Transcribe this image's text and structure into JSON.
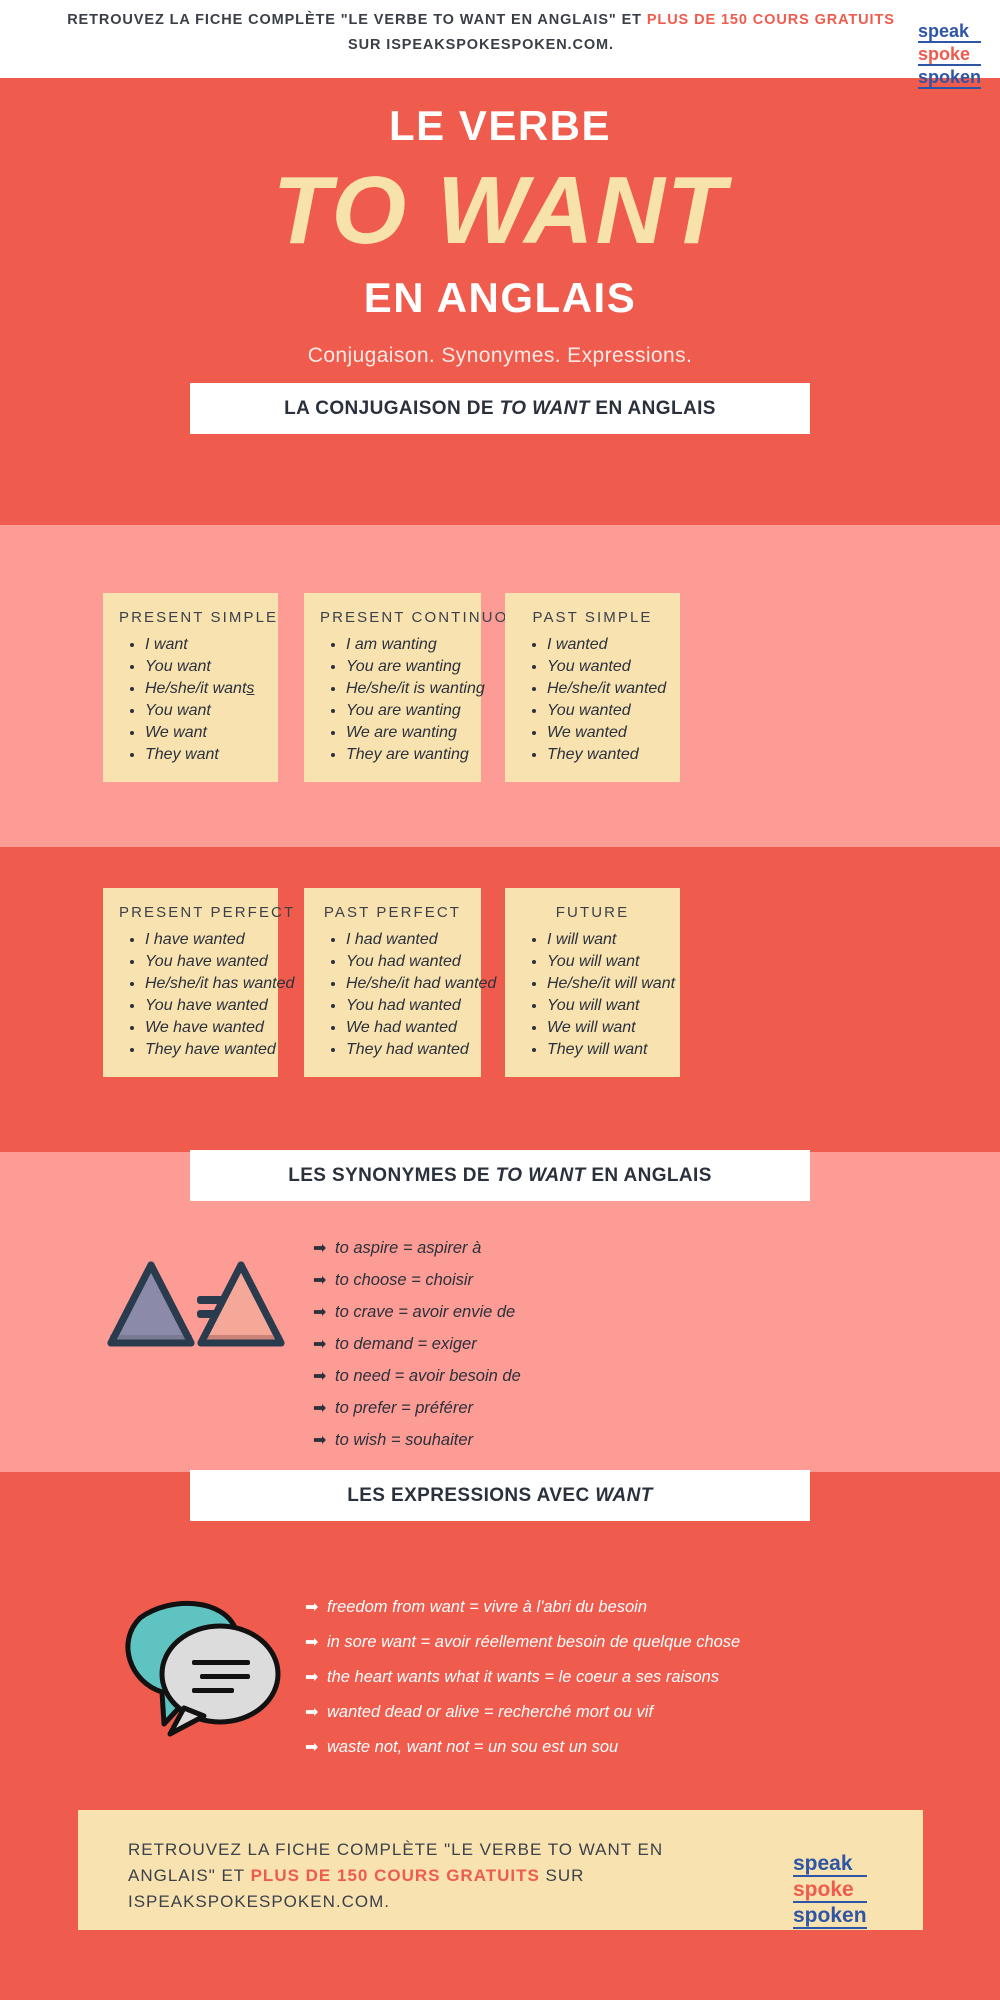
{
  "header": {
    "line1_plain_a": "RETROUVEZ LA FICHE COMPLÈTE \"LE VERBE TO WANT EN ANGLAIS\" ET ",
    "line1_accent": "PLUS",
    "line2_accent": "DE 150 COURS GRATUITS",
    "line2_plain": " SUR ISPEAKSPOKESPOKEN.COM."
  },
  "logo": {
    "row1": "speak",
    "row2": "spoke",
    "row3": "spoken"
  },
  "hero": {
    "line1": "LE VERBE",
    "title": "TO WANT",
    "line3": "EN ANGLAIS",
    "subtitle": "Conjugaison. Synonymes.  Expressions."
  },
  "sections": {
    "conjugaison": {
      "banner_pre": "LA CONJUGAISON DE ",
      "banner_em": "TO WANT",
      "banner_post": " EN ANGLAIS",
      "cards": [
        {
          "title": "PRESENT SIMPLE",
          "items": [
            "I want",
            "You want",
            "He/she/it wants",
            "You want",
            "We want",
            "They want"
          ],
          "underline_last_char_index": 2
        },
        {
          "title": "PRESENT CONTINUOUS",
          "items": [
            "I am wanting",
            "You are wanting",
            "He/she/it is wanting",
            "You are wanting",
            "We are wanting",
            "They are wanting"
          ]
        },
        {
          "title": "PAST SIMPLE",
          "items": [
            "I wanted",
            "You wanted",
            "He/she/it wanted",
            "You wanted",
            "We wanted",
            "They wanted"
          ]
        },
        {
          "title": "PRESENT PERFECT",
          "items": [
            "I have wanted",
            "You have wanted",
            "He/she/it has wanted",
            "You have wanted",
            "We have wanted",
            "They have wanted"
          ]
        },
        {
          "title": "PAST PERFECT",
          "items": [
            "I had wanted",
            "You had wanted",
            "He/she/it had wanted",
            "You had wanted",
            "We had wanted",
            "They had wanted"
          ]
        },
        {
          "title": "FUTURE",
          "items": [
            "I will want",
            "You will want",
            "He/she/it will want",
            "You will want",
            "We will want",
            "They will want"
          ]
        }
      ]
    },
    "synonymes": {
      "banner_pre": "LES SYNONYMES DE ",
      "banner_em": "TO WANT",
      "banner_post": " EN ANGLAIS",
      "icon": "equal-triangles-icon",
      "arrow": "➡",
      "items": [
        "to aspire = aspirer à",
        "to choose = choisir",
        "to crave = avoir envie de",
        "to demand = exiger",
        "to need = avoir besoin de",
        "to prefer = préférer",
        "to wish = souhaiter"
      ]
    },
    "expressions": {
      "banner_pre": "LES EXPRESSIONS AVEC ",
      "banner_em": "WANT",
      "banner_post": "",
      "icon": "speech-bubbles-icon",
      "arrow": "➡",
      "items": [
        "freedom from want = vivre à l'abri du besoin",
        "in sore want = avoir réellement besoin de quelque chose",
        "the heart wants what it wants = le coeur a ses raisons",
        "wanted dead or alive = recherché mort ou vif",
        "waste not, want not = un sou est un sou"
      ]
    }
  },
  "footer": {
    "plain_a": "RETROUVEZ LA FICHE COMPLÈTE \"LE VERBE TO WANT EN ANGLAIS\" ET ",
    "accent": "PLUS DE 150 COURS GRATUITS",
    "plain_b": " SUR ISPEAKSPOKESPOKEN.COM."
  },
  "colors": {
    "brand_red": "#ef5b4c",
    "band_light": "#fd9b95",
    "card_cream": "#f7e2b0",
    "title_cream": "#f7e2a9",
    "ink": "#2b313c",
    "logo_blue": "#2e55a6",
    "bubble_teal": "#5fc3c1",
    "bubble_gray": "#dcdcdc",
    "triangle_navy": "#2b3b4e",
    "triangle_purple": "#8b8aa8",
    "triangle_salmon": "#f5a898"
  }
}
